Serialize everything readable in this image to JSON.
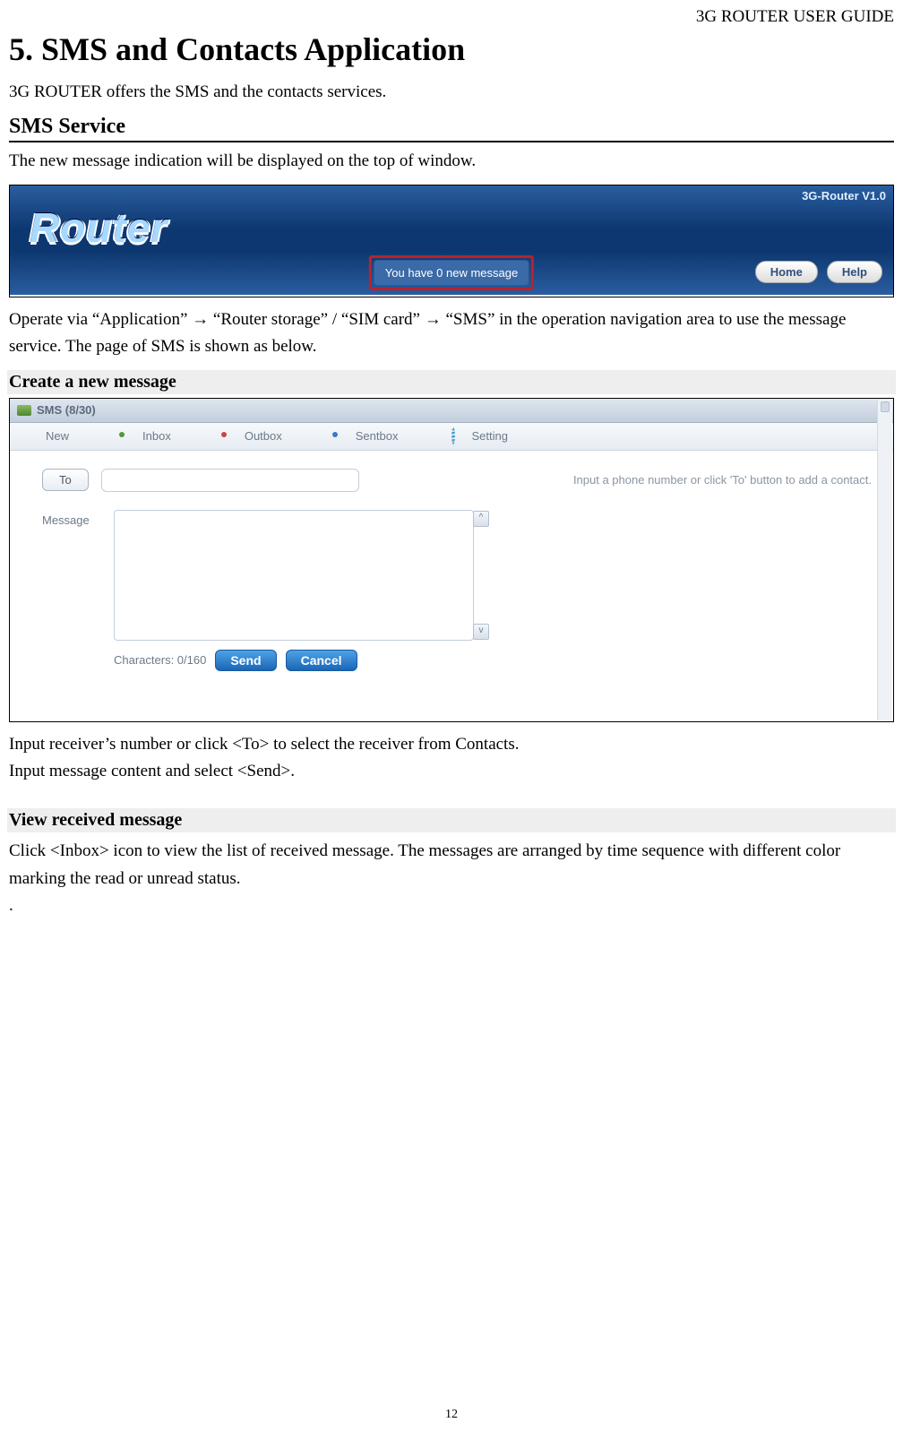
{
  "header": {
    "doc_title": "3G ROUTER USER GUIDE"
  },
  "title": {
    "main": "5. SMS and Contacts Application"
  },
  "intro": {
    "line1": "3G ROUTER offers the SMS and the contacts services."
  },
  "section1": {
    "heading": "SMS Service",
    "para1": "The new message indication will be displayed on the top of window."
  },
  "banner": {
    "logo_text": "Router",
    "version": "3G-Router V1.0",
    "notice": "You have 0 new message",
    "home_btn": "Home",
    "help_btn": "Help"
  },
  "after_banner": {
    "para": "Operate via “Application” → “Router storage” / “SIM card” → “SMS” in the operation navigation area to use the message service. The page of SMS is shown as below."
  },
  "sub1": {
    "heading": "Create a new message"
  },
  "sms_ui": {
    "title": "SMS (8/30)",
    "tabs": {
      "new": "New",
      "inbox": "Inbox",
      "outbox": "Outbox",
      "sentbox": "Sentbox",
      "setting": "Setting"
    },
    "to_btn": "To",
    "hint": "Input a phone number or click 'To' button to add a contact.",
    "msg_label": "Message",
    "char_count": "Characters: 0/160",
    "send_btn": "Send",
    "cancel_btn": "Cancel"
  },
  "after_sms": {
    "line1": "Input receiver’s number or click <To> to select the receiver from Contacts.",
    "line2": "Input message content and select <Send>."
  },
  "sub2": {
    "heading": "View received message"
  },
  "sub2_body": {
    "para": "Click <Inbox> icon to view the list of received message. The messages are arranged by time sequence with different color marking the read or unread status.",
    "dot": "."
  },
  "footer": {
    "page_no": "12"
  }
}
